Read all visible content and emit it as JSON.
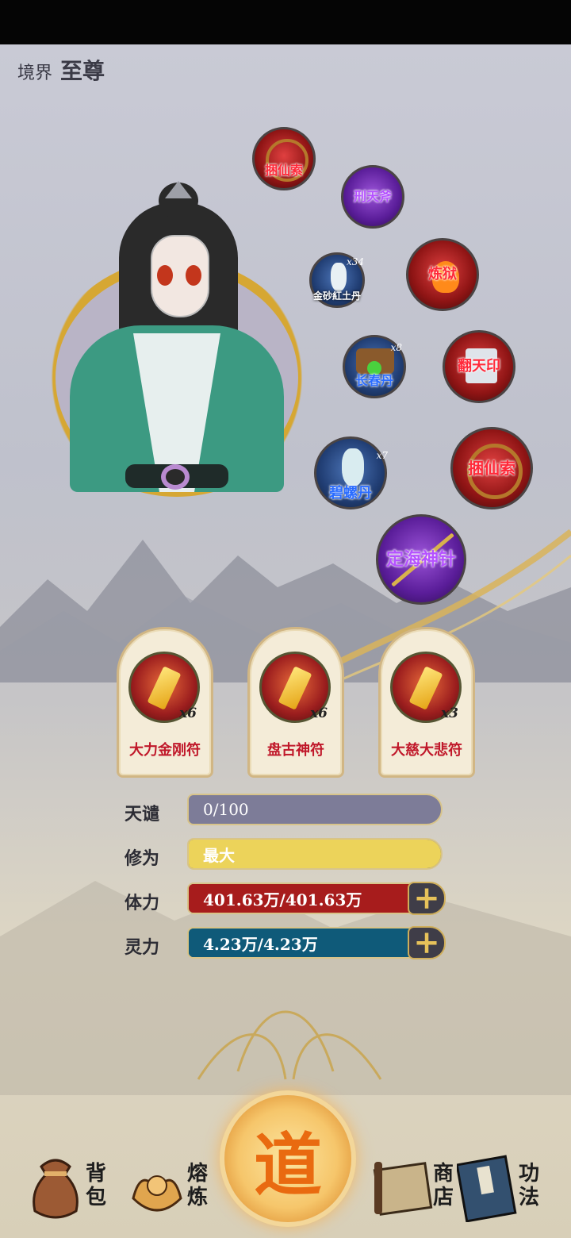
{
  "realm": {
    "label": "境界",
    "value": "至尊"
  },
  "equipment": [
    {
      "name": "捆仙索",
      "rarity": "red",
      "qty": ""
    },
    {
      "name": "刑天斧",
      "rarity": "purple",
      "qty": ""
    },
    {
      "name": "金砂紅土丹",
      "rarity": "blue",
      "qty": "x34"
    },
    {
      "name": "炼狱",
      "rarity": "red",
      "qty": ""
    },
    {
      "name": "长春丹",
      "rarity": "blue",
      "qty": "x8"
    },
    {
      "name": "翻天印",
      "rarity": "red",
      "qty": ""
    },
    {
      "name": "碧螺丹",
      "rarity": "blue",
      "qty": "x7"
    },
    {
      "name": "捆仙索",
      "rarity": "red",
      "qty": ""
    },
    {
      "name": "定海神针",
      "rarity": "purple",
      "qty": ""
    }
  ],
  "talismans": [
    {
      "name": "大力金刚符",
      "count": "x6"
    },
    {
      "name": "盘古神符",
      "count": "x6"
    },
    {
      "name": "大慈大悲符",
      "count": "x3"
    }
  ],
  "stats": [
    {
      "label": "天谴",
      "value": "0/100",
      "fill": 0.0,
      "color": "#7d7c98"
    },
    {
      "label": "修为",
      "value": "最大",
      "fill": 1.0,
      "color": "#ecd35a"
    },
    {
      "label": "体力",
      "value": "401.63万/401.63万",
      "fill": 1.0,
      "color": "#a71c1c"
    },
    {
      "label": "灵力",
      "value": "4.23万/4.23万",
      "fill": 1.0,
      "color": "#0f5a79"
    }
  ],
  "nav": {
    "bag": "背包",
    "smelt": "熔炼",
    "center": "道",
    "shop": "商店",
    "skills": "功法"
  }
}
